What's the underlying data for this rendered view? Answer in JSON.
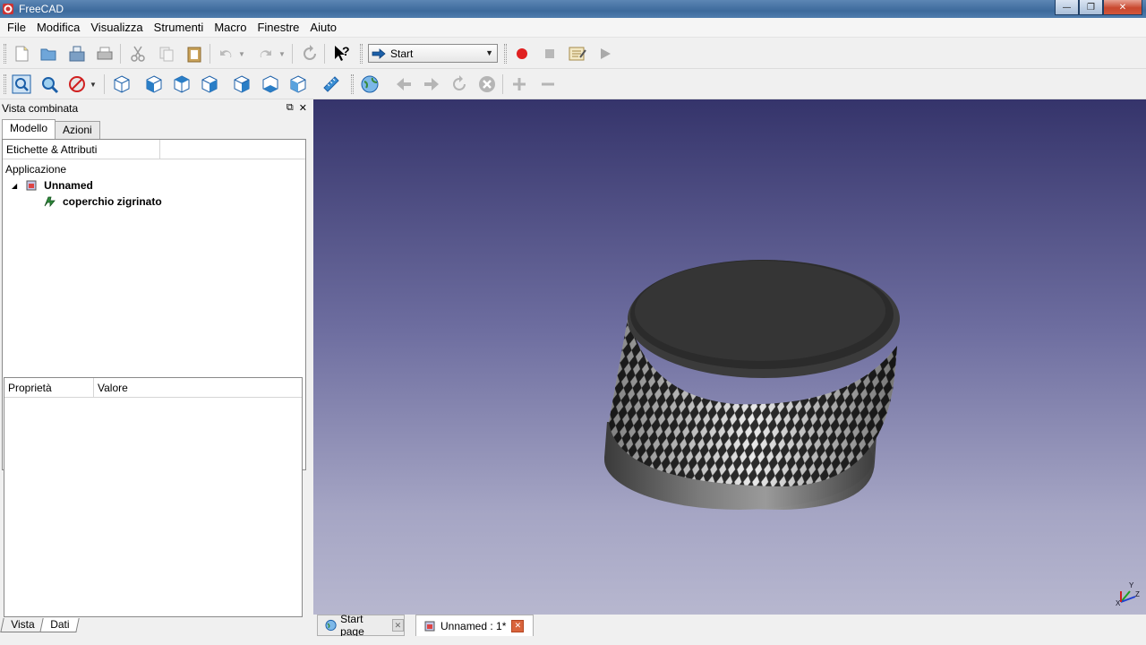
{
  "window": {
    "title": "FreeCAD"
  },
  "window_controls": {
    "minimize": "—",
    "maximize": "❐",
    "close": "✕"
  },
  "menu": [
    "File",
    "Modifica",
    "Visualizza",
    "Strumenti",
    "Macro",
    "Finestre",
    "Aiuto"
  ],
  "toolbar": {
    "workbench_selector": {
      "selected": "Start"
    },
    "help_glyph": "?"
  },
  "combo_view": {
    "title": "Vista combinata",
    "float_glyph": "⧉",
    "close_glyph": "✕",
    "tabs": [
      "Modello",
      "Azioni"
    ],
    "active_tab": "Modello",
    "tree": {
      "header": "Etichette & Attributi",
      "root_label": "Applicazione",
      "document": "Unnamed",
      "object": "coperchio zigrinato"
    },
    "properties": {
      "col_property": "Proprietà",
      "col_value": "Valore"
    },
    "bottom_tabs": [
      "Vista",
      "Dati"
    ],
    "active_bottom_tab": "Dati"
  },
  "document_tabs": [
    {
      "label": "Start page",
      "active": false
    },
    {
      "label": "Unnamed : 1*",
      "active": true
    }
  ],
  "axis_labels": {
    "x": "X",
    "y": "Y",
    "z": "Z"
  },
  "colors": {
    "record": "#e02020",
    "accent_blue": "#1b5fa8",
    "view_top": "#35346b",
    "view_bottom": "#b7b7cf"
  }
}
